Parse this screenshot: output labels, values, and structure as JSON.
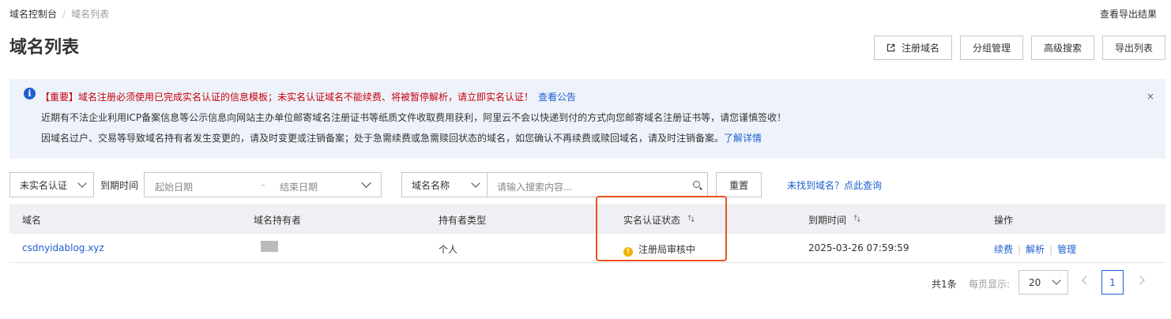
{
  "breadcrumb": {
    "root": "域名控制台",
    "separator": "/",
    "current": "域名列表"
  },
  "header": {
    "export_result_link": "查看导出结果",
    "title": "域名列表"
  },
  "toolbar": {
    "register_label": "注册域名",
    "group_label": "分组管理",
    "advanced_search_label": "高级搜索",
    "export_label": "导出列表"
  },
  "notice": {
    "info_icon": "i",
    "line1": "【重要】域名注册必须使用已完成实名认证的信息模板；未实名认证域名不能续费、将被暂停解析，请立即实名认证！",
    "line1_link": "查看公告",
    "line2": "近期有不法企业利用ICP备案信息等公示信息向网站主办单位邮寄域名注册证书等纸质文件收取费用获利，阿里云不会以快递到付的方式向您邮寄域名注册证书等，请您谨慎签收！",
    "line3": "因域名过户、交易等导致域名持有者发生变更的，请及时变更或注销备案；处于急需续费或急需赎回状态的域名，如您确认不再续费或赎回域名，请及时注销备案。",
    "line3_link": "了解详情",
    "close": "×"
  },
  "filters": {
    "status_select": "未实名认证",
    "expire_label": "到期时间",
    "start_date_placeholder": "起始日期",
    "date_separator": "-",
    "end_date_placeholder": "结束日期",
    "search_type_select": "域名名称",
    "search_placeholder": "请输入搜索内容...",
    "reset_label": "重置",
    "not_found_link": "未找到域名？点此查询"
  },
  "table": {
    "headers": {
      "domain": "域名",
      "holder": "域名持有者",
      "holder_type": "持有者类型",
      "verify_status": "实名认证状态",
      "expire_time": "到期时间",
      "actions": "操作"
    },
    "rows": [
      {
        "domain": "csdnyidablog.xyz",
        "holder_type": "个人",
        "status_icon": "!",
        "verify_status": "注册局审核中",
        "expire_time": "2025-03-26 07:59:59",
        "action_renew": "续费",
        "action_resolve": "解析",
        "action_manage": "管理"
      }
    ]
  },
  "pagination": {
    "total": "共1条",
    "per_page_label": "每页显示:",
    "per_page": "20",
    "current_page": "1"
  },
  "colors": {
    "accent": "#1f5fd2",
    "alert_text": "#c7000b",
    "highlight_border": "#e8521e",
    "warning": "#f0b400"
  }
}
